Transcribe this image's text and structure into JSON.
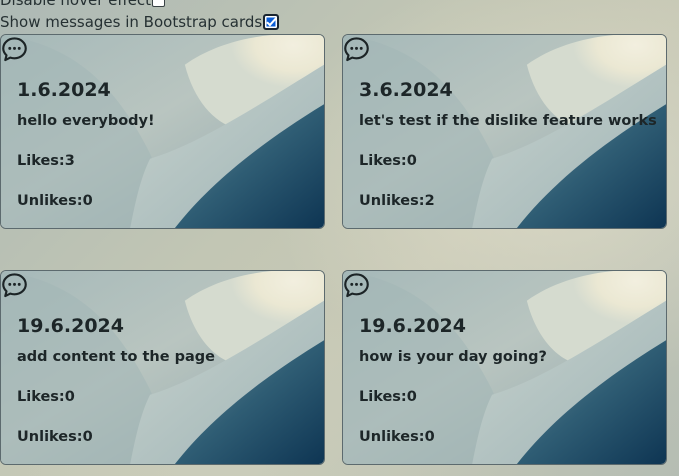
{
  "options": {
    "hover_label": "Disable hover effect",
    "hover_checked": false,
    "cards_label": "Show messages in Bootstrap cards",
    "cards_checked": true
  },
  "likes_label": "Likes:",
  "unlikes_label": "Unlikes:",
  "messages": [
    {
      "date": "1.6.2024",
      "text": "hello everybody!",
      "likes": "3",
      "unlikes": "0",
      "icon": "chat-bubble-icon"
    },
    {
      "date": "3.6.2024",
      "text": "let's test if the dislike feature works",
      "likes": "0",
      "unlikes": "2",
      "icon": "chat-bubble-icon"
    },
    {
      "date": "19.6.2024",
      "text": "add content to the page",
      "likes": "0",
      "unlikes": "0",
      "icon": "chat-bubble-icon"
    },
    {
      "date": "19.6.2024",
      "text": "how is your day going?",
      "likes": "0",
      "unlikes": "0",
      "icon": "chat-bubble-icon"
    }
  ]
}
